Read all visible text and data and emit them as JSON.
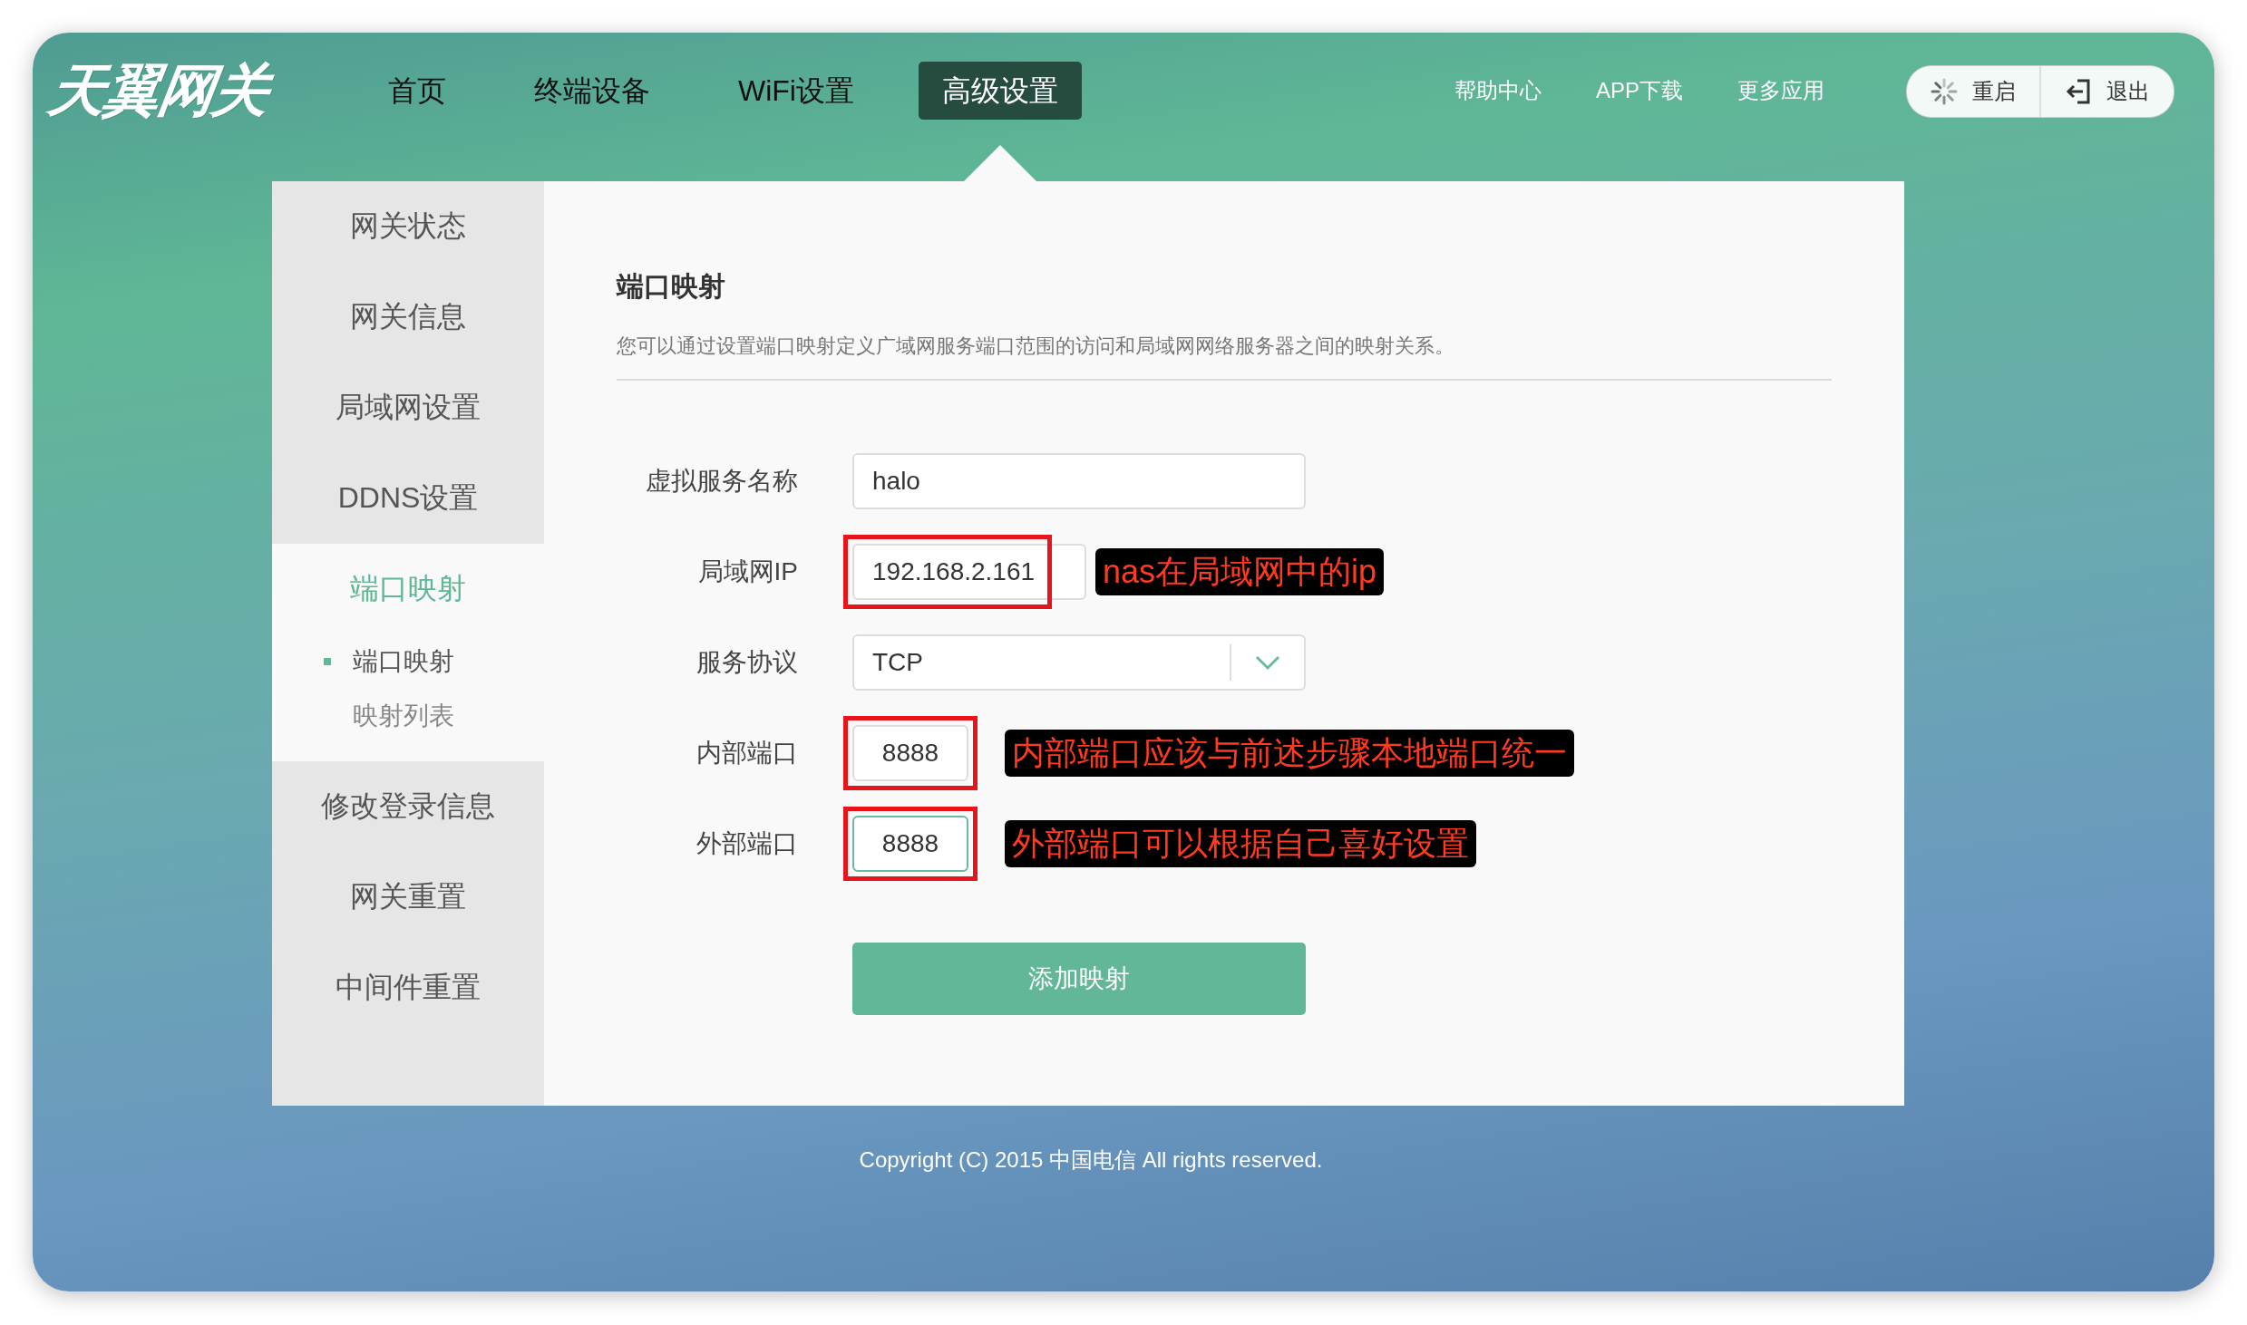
{
  "logo": "天翼网关",
  "nav": [
    {
      "label": "首页",
      "selected": false
    },
    {
      "label": "终端设备",
      "selected": false
    },
    {
      "label": "WiFi设置",
      "selected": false
    },
    {
      "label": "高级设置",
      "selected": true
    }
  ],
  "links": [
    "帮助中心",
    "APP下载",
    "更多应用"
  ],
  "actions": [
    {
      "label": "重启",
      "kind": "restart"
    },
    {
      "label": "退出",
      "kind": "logout"
    }
  ],
  "sidebar": [
    {
      "label": "网关状态",
      "selected": false
    },
    {
      "label": "网关信息",
      "selected": false
    },
    {
      "label": "局域网设置",
      "selected": false
    },
    {
      "label": "DDNS设置",
      "selected": false
    },
    {
      "label": "端口映射",
      "selected": true,
      "children": [
        {
          "label": "端口映射",
          "selected": true
        },
        {
          "label": "映射列表",
          "selected": false
        }
      ]
    },
    {
      "label": "修改登录信息",
      "selected": false
    },
    {
      "label": "网关重置",
      "selected": false
    },
    {
      "label": "中间件重置",
      "selected": false
    }
  ],
  "section": {
    "title": "端口映射",
    "description": "您可以通过设置端口映射定义广域网服务端口范围的访问和局域网网络服务器之间的映射关系。"
  },
  "form": [
    {
      "label": "虚拟服务名称",
      "kind": "text",
      "value": "halo",
      "highlighted": false,
      "focused": false
    },
    {
      "label": "局域网IP",
      "kind": "text",
      "value": "192.168.2.161",
      "highlighted": true,
      "focused": false,
      "note": "nas在局域网中的ip"
    },
    {
      "label": "服务协议",
      "kind": "select",
      "value": "TCP",
      "highlighted": false,
      "focused": false
    },
    {
      "label": "内部端口",
      "kind": "port",
      "value": "8888",
      "highlighted": true,
      "focused": false,
      "note": "内部端口应该与前述步骤本地端口统一"
    },
    {
      "label": "外部端口",
      "kind": "port",
      "value": "8888",
      "highlighted": true,
      "focused": true,
      "note": "外部端口可以根据自己喜好设置"
    }
  ],
  "submit": "添加映射",
  "footer": "Copyright (C) 2015 中国电信 All rights reserved."
}
